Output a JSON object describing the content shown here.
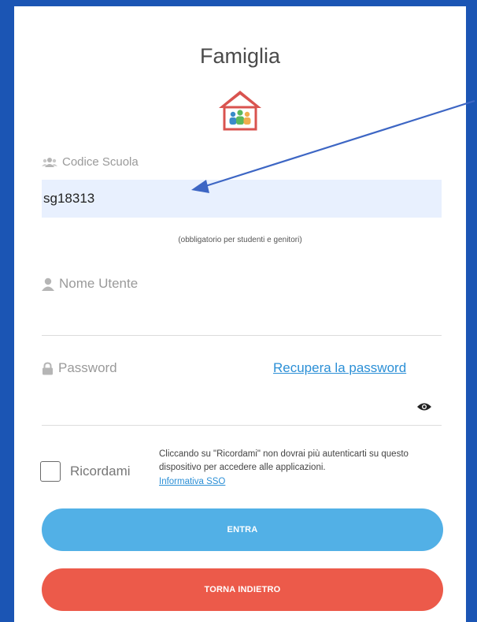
{
  "header": {
    "title": "Famiglia"
  },
  "form": {
    "school_code": {
      "label": "Codice Scuola",
      "value": "sg18313",
      "hint": "(obbligatorio per studenti e genitori)"
    },
    "username": {
      "label": "Nome Utente",
      "value": ""
    },
    "password": {
      "label": "Password",
      "value": "",
      "recover_link": "Recupera la password"
    },
    "remember": {
      "label": "Ricordami",
      "note": "Cliccando su \"Ricordami\" non dovrai più autenticarti su questo dispositivo per accedere alle applicazioni.",
      "sso_link": "Informativa SSO",
      "checked": false
    },
    "buttons": {
      "enter": "ENTRA",
      "back": "TORNA INDIETRO"
    }
  },
  "colors": {
    "frame": "#1b55b4",
    "enter_button": "#52b0e6",
    "back_button": "#ec5a4a",
    "link": "#2b8fd6",
    "annotation_arrow": "#3d66c4"
  },
  "icons": [
    "family-house-icon",
    "users-icon",
    "user-icon",
    "lock-icon",
    "eye-icon"
  ]
}
